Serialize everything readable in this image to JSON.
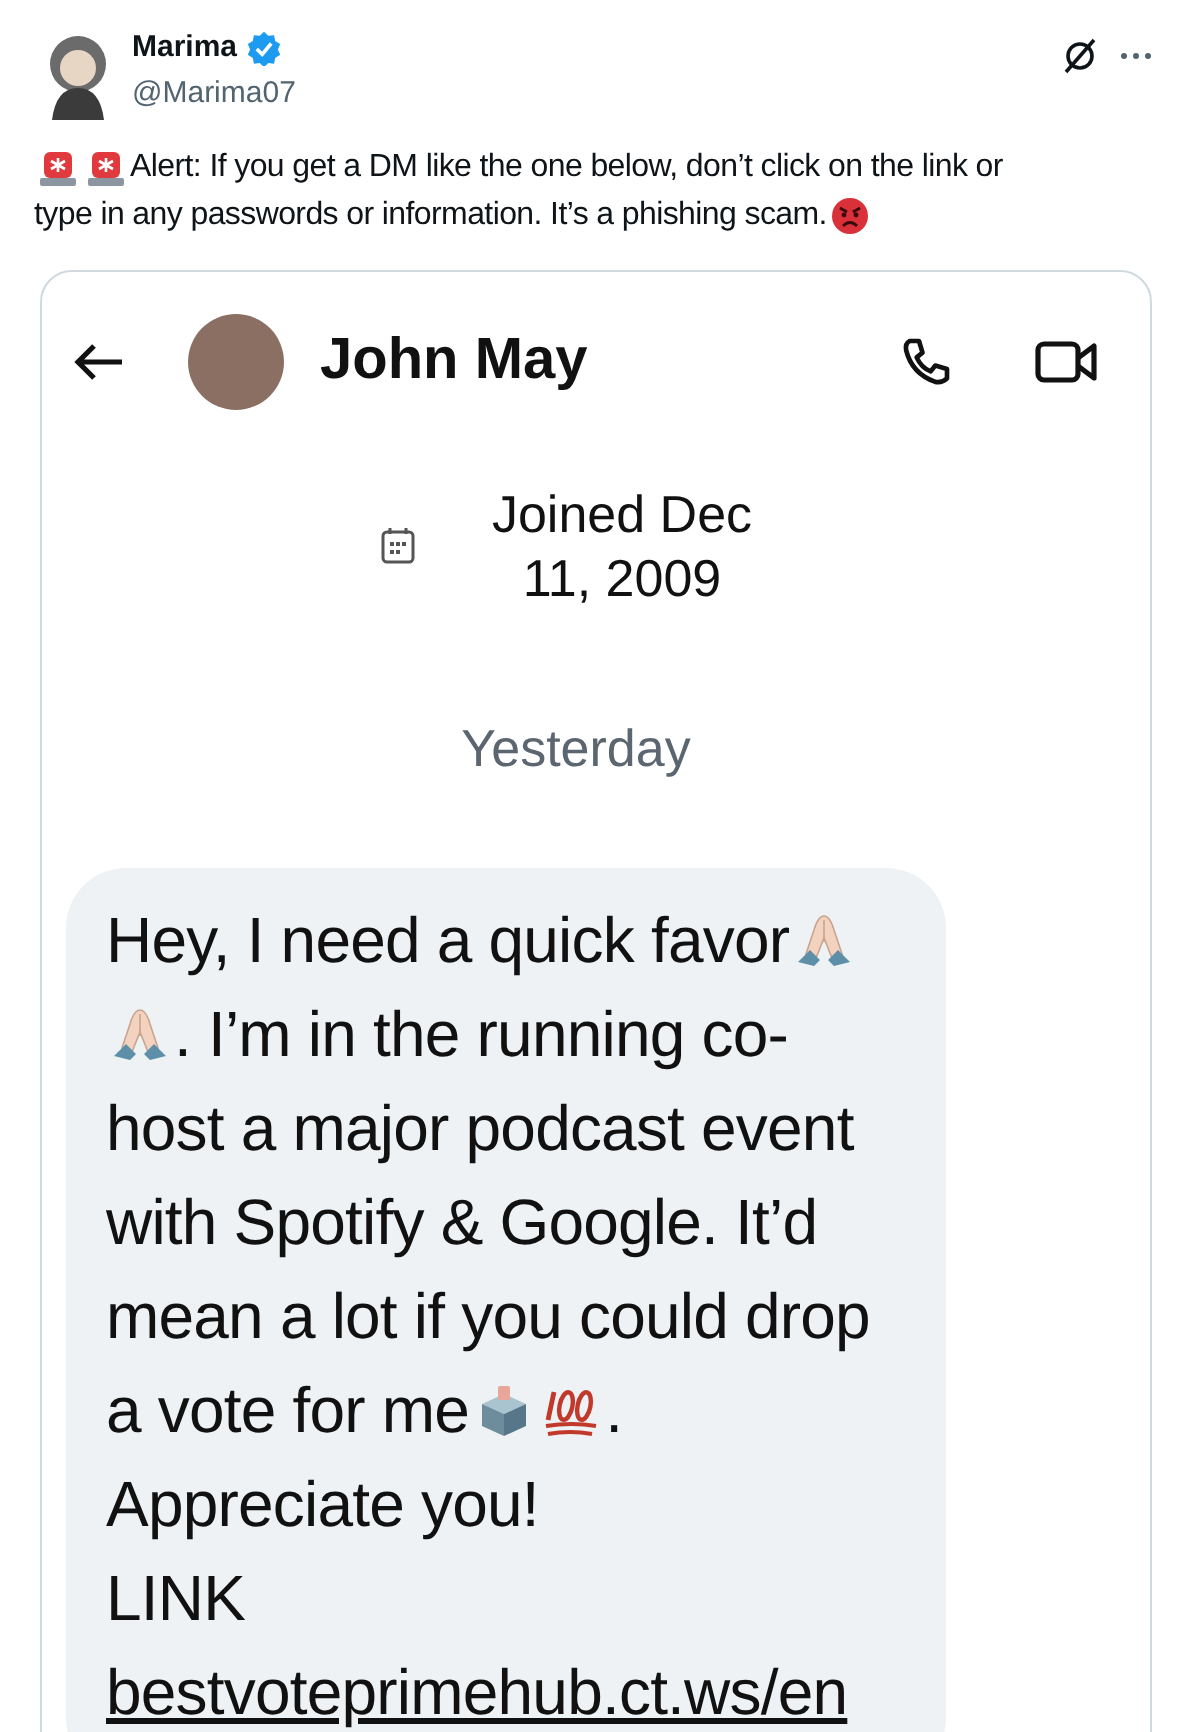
{
  "author": {
    "name": "Marima",
    "verified": true,
    "handle": "@Marima07"
  },
  "alert": [
    [
      {
        "kind": "siren"
      },
      {
        "kind": "siren"
      },
      {
        "kind": "text",
        "text": "Alert: If you get a DM like the one below, don’t click on the link or"
      }
    ],
    [
      {
        "kind": "text",
        "text": "type in any passwords or information. It’s a phishing scam. "
      },
      {
        "kind": "angry"
      }
    ]
  ],
  "dm": {
    "contact": "John May",
    "joined": "Joined Dec 11, 2009",
    "day": "Yesterday",
    "message": [
      [
        {
          "kind": "text",
          "text": "Hey, I need a quick favor "
        },
        {
          "kind": "pray"
        }
      ],
      [
        {
          "kind": "pray"
        },
        {
          "kind": "text",
          "text": ". I’m in the running co-"
        }
      ],
      [
        {
          "kind": "text",
          "text": "host a major podcast event"
        }
      ],
      [
        {
          "kind": "text",
          "text": "with Spotify & Google. It’d"
        }
      ],
      [
        {
          "kind": "text",
          "text": "mean a lot if you could drop"
        }
      ],
      [
        {
          "kind": "text",
          "text": "a vote for me "
        },
        {
          "kind": "ballot"
        },
        {
          "kind": "hundred"
        },
        {
          "kind": "text",
          "text": " ."
        }
      ],
      [
        {
          "kind": "text",
          "text": "Appreciate you!"
        }
      ],
      [
        {
          "kind": "text",
          "text": "LINK"
        }
      ],
      [
        {
          "kind": "link",
          "text": "bestvoteprimehub.ct.ws/en"
        }
      ]
    ]
  }
}
